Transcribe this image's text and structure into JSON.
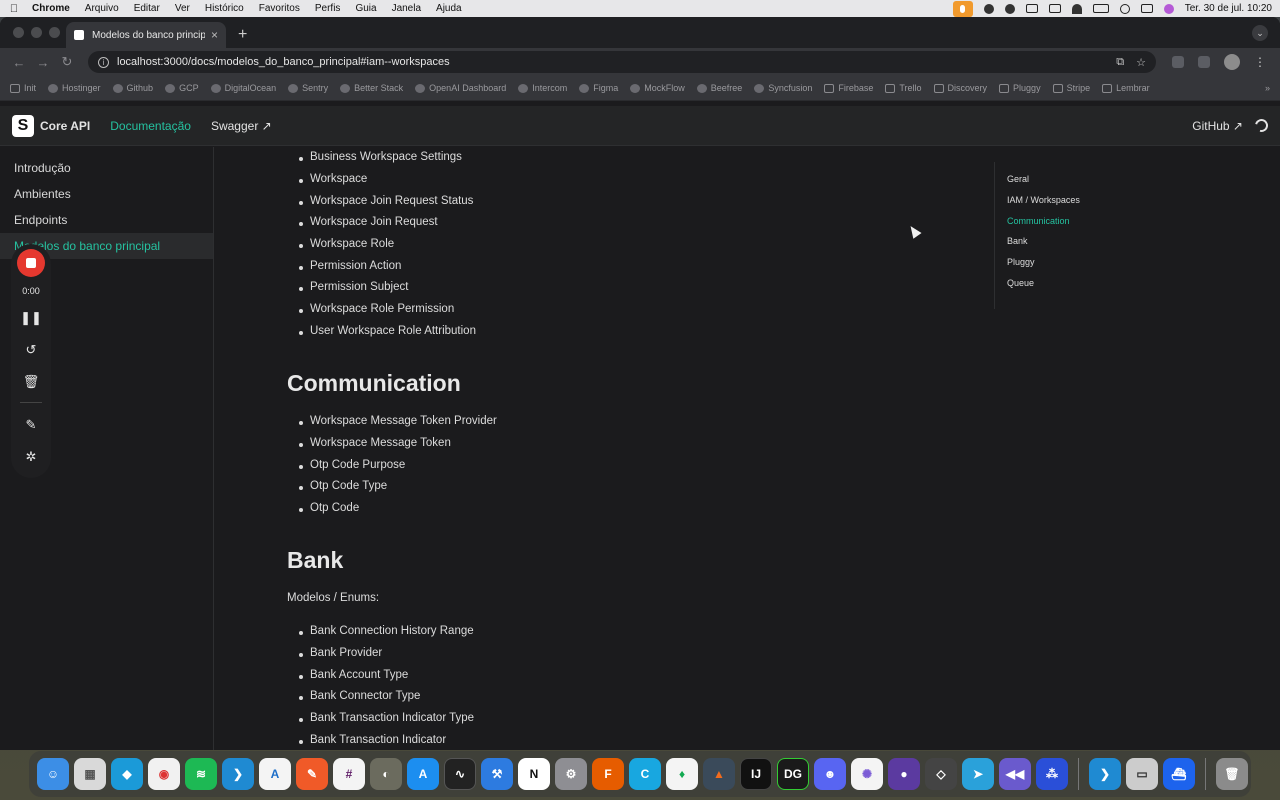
{
  "menubar": {
    "app": "Chrome",
    "items": [
      "Arquivo",
      "Editar",
      "Ver",
      "Histórico",
      "Favoritos",
      "Perfis",
      "Guia",
      "Janela",
      "Ajuda"
    ],
    "clock": "Ter. 30 de jul.  10:20"
  },
  "browser": {
    "tab_title": "Modelos do banco principal |",
    "url": "localhost:3000/docs/modelos_do_banco_principal#iam--workspaces",
    "bookmarks": [
      "Init",
      "Hostinger",
      "Github",
      "GCP",
      "DigitalOcean",
      "Sentry",
      "Better Stack",
      "OpenAI Dashboard",
      "Intercom",
      "Figma",
      "MockFlow",
      "Beefree",
      "Syncfusion",
      "Firebase",
      "Trello",
      "Discovery",
      "Pluggy",
      "Stripe",
      "Lembrar"
    ]
  },
  "navbar": {
    "brand": "Core API",
    "links": [
      "Documentação",
      "Swagger ↗"
    ],
    "github": "GitHub ↗"
  },
  "sidebar": {
    "items": [
      "Introdução",
      "Ambientes",
      "Endpoints",
      "Modelos do banco principal"
    ],
    "active_index": 3
  },
  "content": {
    "iam_items": [
      "Business Workspace Settings",
      "Workspace",
      "Workspace Join Request Status",
      "Workspace Join Request",
      "Workspace Role",
      "Permission Action",
      "Permission Subject",
      "Workspace Role Permission",
      "User Workspace Role Attribution"
    ],
    "communication_heading": "Communication",
    "communication_items": [
      "Workspace Message Token Provider",
      "Workspace Message Token",
      "Otp Code Purpose",
      "Otp Code Type",
      "Otp Code"
    ],
    "bank_heading": "Bank",
    "bank_intro": "Modelos / Enums:",
    "bank_items": [
      "Bank Connection History Range",
      "Bank Provider",
      "Bank Account Type",
      "Bank Connector Type",
      "Bank Transaction Indicator Type",
      "Bank Transaction Indicator"
    ]
  },
  "toc": {
    "items": [
      "Geral",
      "IAM / Workspaces",
      "Communication",
      "Bank",
      "Pluggy",
      "Queue"
    ],
    "active_index": 2
  },
  "recorder": {
    "timer": "0:00"
  },
  "colors": {
    "accent": "#25c2a0",
    "record": "#e5382f"
  },
  "dock": {
    "icons": [
      "finder-icon",
      "launchpad-icon",
      "app-icon",
      "chrome-icon",
      "spotify-icon",
      "vscode-icon",
      "app-icon",
      "pencil-app-icon",
      "slack-icon",
      "gimp-icon",
      "appstore-icon",
      "activity-monitor-icon",
      "xcode-icon",
      "notion-icon",
      "system-settings-icon",
      "app-icon",
      "app-icon",
      "mongodb-icon",
      "matlab-icon",
      "intellij-icon",
      "datagrip-icon",
      "discord-icon",
      "app-icon",
      "app-icon",
      "unity-icon",
      "telegram-icon",
      "app-icon",
      "app-icon"
    ]
  }
}
